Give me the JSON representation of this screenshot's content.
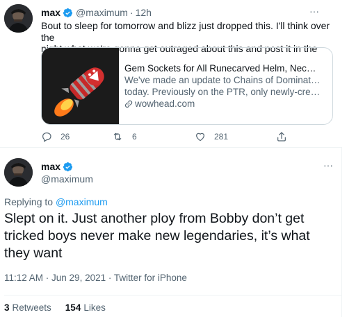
{
  "first_tweet": {
    "author_name": "max",
    "handle": "@maximum",
    "separator": "·",
    "time": "12h",
    "text_line1": "Bout to sleep for tomorrow and blizz just dropped this.  I'll think over the",
    "text_line2": "night what we're gonna get outraged about this and post it in the morning",
    "link_card": {
      "title": "Gem Sockets for All Runecarved Helm, Neck, Brace...",
      "desc_line1": "We've made an update to Chains of Domination",
      "desc_line2": "today. Previously on the PTR, only newly-created ...",
      "domain": "wowhead.com"
    },
    "actions": {
      "reply_count": "26",
      "retweet_count": "6",
      "like_count": "281",
      "reply_icon": "reply-icon",
      "retweet_icon": "retweet-icon",
      "like_icon": "heart-icon",
      "share_icon": "share-icon"
    }
  },
  "main_tweet": {
    "author_name": "max",
    "handle": "@maximum",
    "replying_prefix": "Replying to ",
    "replying_to": "@maximum",
    "text": "Slept on it.  Just another ploy from Bobby don’t get tricked boys never make new legendaries, it’s what they want",
    "meta": "11:12 AM · Jun 29, 2021 · Twitter for iPhone",
    "retweets_count": "3",
    "retweets_label": "Retweets",
    "likes_count": "154",
    "likes_label": "Likes"
  },
  "colors": {
    "accent": "#1d9bf0",
    "text_primary": "#0f1419",
    "text_secondary": "#536471",
    "border": "#cfd9de"
  }
}
